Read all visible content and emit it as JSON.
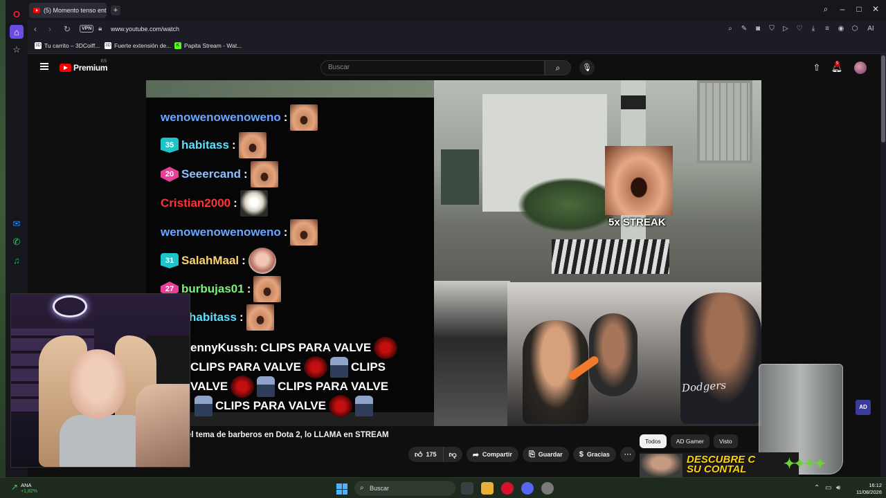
{
  "browser": {
    "tab_title": "(5) Momento tenso entre",
    "url": "www.youtube.com/watch",
    "vpn_label": "VPN",
    "bookmarks": [
      {
        "label": "Tu carrito – 3DCoiff..."
      },
      {
        "label": "Fuerte extensión de..."
      },
      {
        "label": "Papita Stream - Wat..."
      }
    ],
    "ai_label": "AI"
  },
  "youtube": {
    "logo_text": "Premium",
    "country_code": "ES",
    "search_placeholder": "Buscar",
    "notification_count": "5",
    "video_title": "el tema de barberos en Dota 2, lo LLAMA en STREAM",
    "actions": {
      "like_count": "175",
      "share_label": "Compartir",
      "save_label": "Guardar",
      "thanks_label": "Gracias"
    },
    "chips": [
      "Todos",
      "AD Gamer",
      "Visto"
    ],
    "promo_text": "DESCUBRE C\nSU CONTAL"
  },
  "video": {
    "streak_label": "5x STREAK",
    "shirt_text": "Dodgers",
    "ad_badge": "AD",
    "chat": [
      {
        "user": "wenowenowenoweno",
        "color": "#6ba7ff",
        "badge": ""
      },
      {
        "user": "habitass",
        "color": "#5ee0ff",
        "badge": "35"
      },
      {
        "user": "Seeercand",
        "color": "#8fc1ff",
        "badge": "20"
      },
      {
        "user": "Cristian2000",
        "color": "#ff3434",
        "badge": ""
      },
      {
        "user": "wenowenowenoweno",
        "color": "#6ba7ff",
        "badge": ""
      },
      {
        "user": "SalahMaal",
        "color": "#ffd36b",
        "badge": "31"
      },
      {
        "user": "burbujas01",
        "color": "#7ef07e",
        "badge": "27"
      },
      {
        "user": "habitass",
        "color": "#5ee0ff",
        "badge": ""
      }
    ],
    "spam_user": "ennyKussh:",
    "spam_text": "CLIPS PARA VALVE",
    "spam_partial_left": "VALVE",
    "spam_partial_right": "CLIPS"
  },
  "taskbar": {
    "stock_name": "ANA",
    "stock_change": "+1,82%",
    "search_label": "Buscar",
    "time": "16:12",
    "date": "11/08/2026"
  }
}
